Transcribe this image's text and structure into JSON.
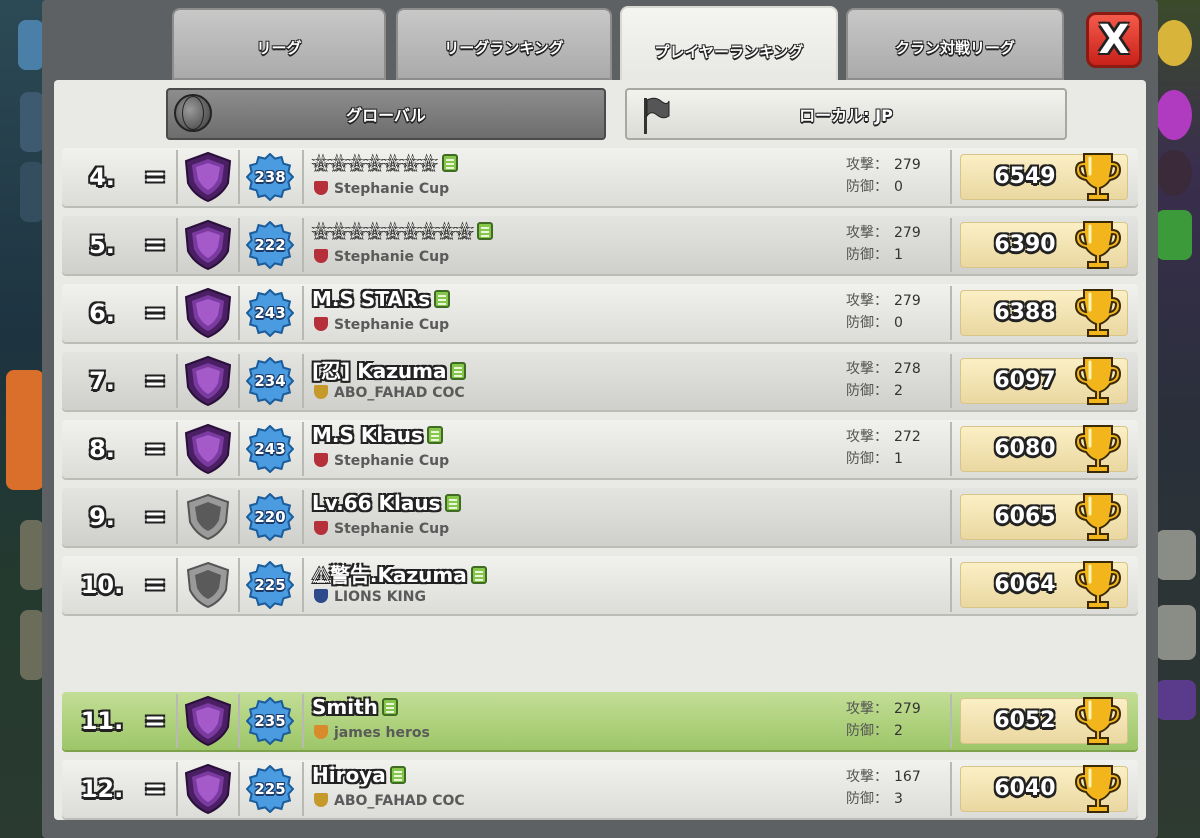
{
  "tabs": [
    {
      "label": "リーグ",
      "active": false
    },
    {
      "label": "リーグランキング",
      "active": false
    },
    {
      "label": "プレイヤーランキング",
      "active": true
    },
    {
      "label": "クラン対戦リーグ",
      "active": false
    }
  ],
  "close_label": "X",
  "filters": {
    "global": "グローバル",
    "local": "ローカル: JP"
  },
  "stat_labels": {
    "attack": "攻撃：",
    "defense": "防御："
  },
  "players": [
    {
      "rank": "4.",
      "change": "=",
      "shield": "legend",
      "level": "238",
      "name": "☆☆☆☆☆☆☆",
      "clan": "Stephanie Cup",
      "clan_badge": "#b5303a",
      "attacks": "279",
      "defenses": "0",
      "trophies": "6549"
    },
    {
      "rank": "5.",
      "change": "=",
      "shield": "legend",
      "level": "222",
      "name": "☆☆☆☆☆☆☆☆☆",
      "clan": "Stephanie Cup",
      "clan_badge": "#b5303a",
      "attacks": "279",
      "defenses": "1",
      "trophies": "6390"
    },
    {
      "rank": "6.",
      "change": "=",
      "shield": "legend",
      "level": "243",
      "name": "M.S STARs",
      "clan": "Stephanie Cup",
      "clan_badge": "#b5303a",
      "attacks": "279",
      "defenses": "0",
      "trophies": "6388"
    },
    {
      "rank": "7.",
      "change": "=",
      "shield": "legend",
      "level": "234",
      "name": "[忍] Kazuma",
      "clan": "ABO_FAHAD COC",
      "clan_badge": "#c59a2a",
      "attacks": "278",
      "defenses": "2",
      "trophies": "6097"
    },
    {
      "rank": "8.",
      "change": "=",
      "shield": "legend",
      "level": "243",
      "name": "M.S Klaus",
      "clan": "Stephanie Cup",
      "clan_badge": "#b5303a",
      "attacks": "272",
      "defenses": "1",
      "trophies": "6080"
    },
    {
      "rank": "9.",
      "change": "=",
      "shield": "empty",
      "level": "220",
      "name": "Lv.66 Klaus",
      "clan": "Stephanie Cup",
      "clan_badge": "#b5303a",
      "attacks": "",
      "defenses": "",
      "trophies": "6065"
    },
    {
      "rank": "10.",
      "change": "=",
      "shield": "empty",
      "level": "225",
      "name": "⚠警告.Kazuma",
      "clan": "LIONS KING",
      "clan_badge": "#2d4a8a",
      "attacks": "",
      "defenses": "",
      "trophies": "6064"
    },
    {
      "rank": "11.",
      "change": "=",
      "shield": "legend",
      "level": "235",
      "name": "Smith",
      "clan": "james heros",
      "clan_badge": "#d98a2a",
      "attacks": "279",
      "defenses": "2",
      "trophies": "6052",
      "highlight": true
    },
    {
      "rank": "12.",
      "change": "=",
      "shield": "legend",
      "level": "225",
      "name": "Hiroya",
      "clan": "ABO_FAHAD COC",
      "clan_badge": "#c59a2a",
      "attacks": "167",
      "defenses": "3",
      "trophies": "6040"
    }
  ],
  "colors": {
    "legend_shield": "#7b3aa0",
    "level_badge": "#4a9be0",
    "trophy_gold": "#f2b51c",
    "highlight_row": "#a8cf74"
  }
}
